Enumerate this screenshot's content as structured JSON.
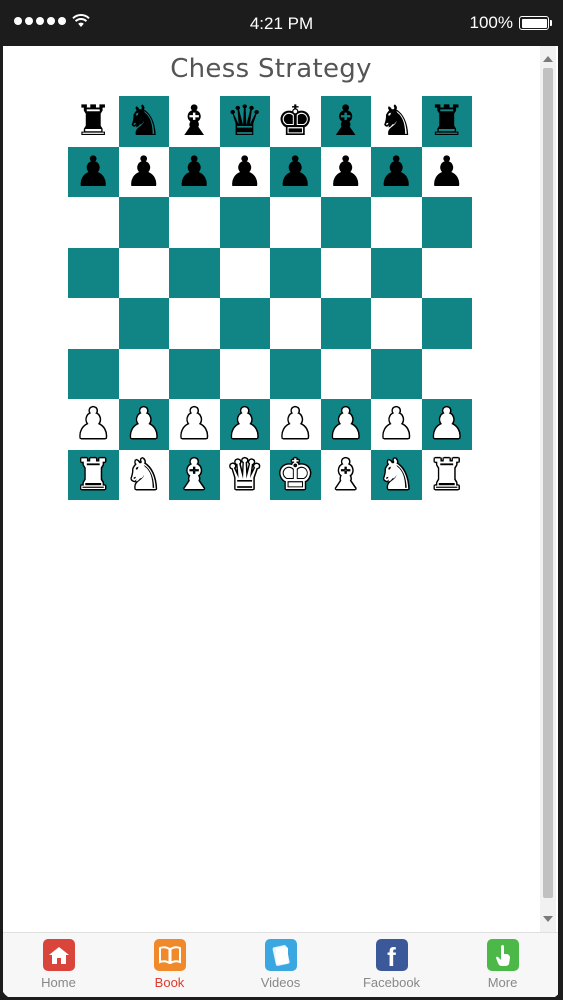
{
  "status_bar": {
    "time": "4:21 PM",
    "battery_text": "100%",
    "battery_level": 1.0
  },
  "page": {
    "title": "Chess Strategy"
  },
  "board": {
    "light_color": "#ffffff",
    "dark_color": "#118585",
    "rows": [
      [
        {
          "g": "♜",
          "c": "black",
          "n": "black-rook"
        },
        {
          "g": "♞",
          "c": "black",
          "n": "black-knight"
        },
        {
          "g": "♝",
          "c": "black",
          "n": "black-bishop"
        },
        {
          "g": "♛",
          "c": "black",
          "n": "black-queen"
        },
        {
          "g": "♚",
          "c": "black",
          "n": "black-king"
        },
        {
          "g": "♝",
          "c": "black",
          "n": "black-bishop"
        },
        {
          "g": "♞",
          "c": "black",
          "n": "black-knight"
        },
        {
          "g": "♜",
          "c": "black",
          "n": "black-rook"
        }
      ],
      [
        {
          "g": "♟",
          "c": "black",
          "n": "black-pawn"
        },
        {
          "g": "♟",
          "c": "black",
          "n": "black-pawn"
        },
        {
          "g": "♟",
          "c": "black",
          "n": "black-pawn"
        },
        {
          "g": "♟",
          "c": "black",
          "n": "black-pawn"
        },
        {
          "g": "♟",
          "c": "black",
          "n": "black-pawn"
        },
        {
          "g": "♟",
          "c": "black",
          "n": "black-pawn"
        },
        {
          "g": "♟",
          "c": "black",
          "n": "black-pawn"
        },
        {
          "g": "♟",
          "c": "black",
          "n": "black-pawn"
        }
      ],
      [
        null,
        null,
        null,
        null,
        null,
        null,
        null,
        null
      ],
      [
        null,
        null,
        null,
        null,
        null,
        null,
        null,
        null
      ],
      [
        null,
        null,
        null,
        null,
        null,
        null,
        null,
        null
      ],
      [
        null,
        null,
        null,
        null,
        null,
        null,
        null,
        null
      ],
      [
        {
          "g": "♟",
          "c": "white",
          "n": "white-pawn"
        },
        {
          "g": "♟",
          "c": "white",
          "n": "white-pawn"
        },
        {
          "g": "♟",
          "c": "white",
          "n": "white-pawn"
        },
        {
          "g": "♟",
          "c": "white",
          "n": "white-pawn"
        },
        {
          "g": "♟",
          "c": "white",
          "n": "white-pawn"
        },
        {
          "g": "♟",
          "c": "white",
          "n": "white-pawn"
        },
        {
          "g": "♟",
          "c": "white",
          "n": "white-pawn"
        },
        {
          "g": "♟",
          "c": "white",
          "n": "white-pawn"
        }
      ],
      [
        {
          "g": "♜",
          "c": "white",
          "n": "white-rook"
        },
        {
          "g": "♞",
          "c": "white",
          "n": "white-knight"
        },
        {
          "g": "♝",
          "c": "white",
          "n": "white-bishop"
        },
        {
          "g": "♛",
          "c": "white",
          "n": "white-queen"
        },
        {
          "g": "♚",
          "c": "white",
          "n": "white-king"
        },
        {
          "g": "♝",
          "c": "white",
          "n": "white-bishop"
        },
        {
          "g": "♞",
          "c": "white",
          "n": "white-knight"
        },
        {
          "g": "♜",
          "c": "white",
          "n": "white-rook"
        }
      ]
    ]
  },
  "tabs": [
    {
      "label": "Home",
      "icon": "home-icon",
      "color": "#d9453b",
      "active": false
    },
    {
      "label": "Book",
      "icon": "book-icon",
      "color": "#f0892a",
      "active": true
    },
    {
      "label": "Videos",
      "icon": "videos-icon",
      "color": "#3aa7e0",
      "active": false
    },
    {
      "label": "Facebook",
      "icon": "facebook-icon",
      "color": "#3b5998",
      "active": false
    },
    {
      "label": "More",
      "icon": "more-icon",
      "color": "#4cb848",
      "active": false
    }
  ],
  "colors": {
    "active_tab": "#e03a2e",
    "inactive_tab": "#888888"
  }
}
